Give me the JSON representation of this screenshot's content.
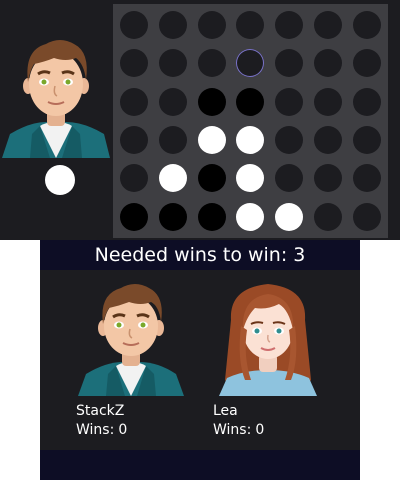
{
  "board": {
    "rows": 6,
    "cols": 7,
    "cells": [
      [
        "empty",
        "empty",
        "empty",
        "empty",
        "empty",
        "empty",
        "empty"
      ],
      [
        "empty",
        "empty",
        "empty",
        "hover",
        "empty",
        "empty",
        "empty"
      ],
      [
        "empty",
        "empty",
        "black",
        "black",
        "empty",
        "empty",
        "empty"
      ],
      [
        "empty",
        "empty",
        "white",
        "white",
        "empty",
        "empty",
        "empty"
      ],
      [
        "empty",
        "white",
        "black",
        "white",
        "empty",
        "empty",
        "empty"
      ],
      [
        "black",
        "black",
        "black",
        "white",
        "white",
        "empty",
        "empty"
      ]
    ]
  },
  "current_turn": {
    "disc_color": "white"
  },
  "header": {
    "needed_wins_text": "Needed wins to win: 3"
  },
  "players": [
    {
      "name": "StackZ",
      "wins_label": "Wins:",
      "wins": "0",
      "avatar": "male-avatar-icon"
    },
    {
      "name": "Lea",
      "wins_label": "Wins:",
      "wins": "0",
      "avatar": "female-avatar-icon"
    }
  ],
  "colors": {
    "background": "#1c1c20",
    "board": "#3e3e42",
    "banner": "#0d0d25",
    "disc_white": "#ffffff",
    "disc_black": "#000000",
    "hover_outline": "#7a73c9"
  }
}
